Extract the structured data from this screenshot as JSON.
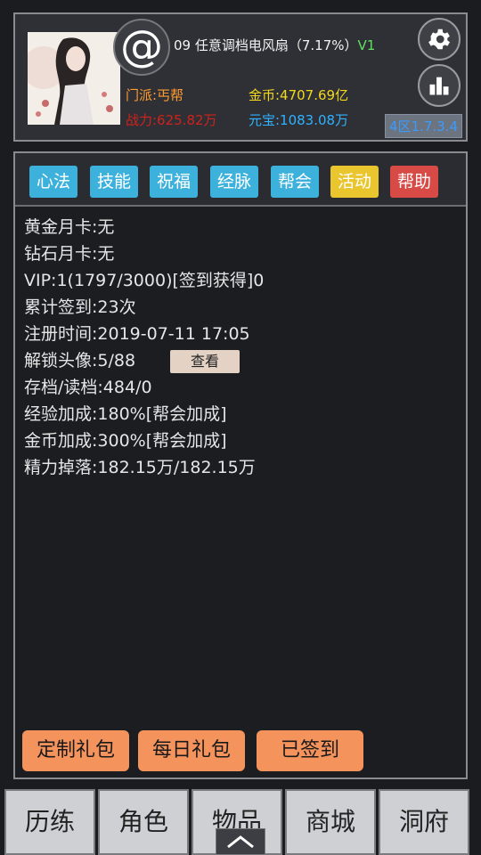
{
  "header": {
    "player_name": "09 任意调档电风扇（7.17%）",
    "vip_level": "V1",
    "sect": "门派:丐帮",
    "power": "战力:625.82万",
    "gold": "金币:4707.69亿",
    "yuanbao": "元宝:1083.08万",
    "server": "4区1.7.3.4",
    "at_symbol": "@"
  },
  "tabs": [
    {
      "label": "心法",
      "color": "#3cb1dc"
    },
    {
      "label": "技能",
      "color": "#3cb1dc"
    },
    {
      "label": "祝福",
      "color": "#3cb1dc"
    },
    {
      "label": "经脉",
      "color": "#3cb1dc"
    },
    {
      "label": "帮会",
      "color": "#3cb1dc"
    },
    {
      "label": "活动",
      "color": "#e9c52e"
    },
    {
      "label": "帮助",
      "color": "#d84a45"
    }
  ],
  "info": {
    "gold_card": "黄金月卡:无",
    "diamond_card": "钻石月卡:无",
    "vip": "VIP:1(1797/3000)[签到获得]0",
    "checkin": "累计签到:23次",
    "register": "注册时间:2019-07-11 17:05",
    "avatars": "解锁头像:5/88",
    "view_button": "查看",
    "saves": "存档/读档:484/0",
    "exp_bonus": "经验加成:180%[帮会加成]",
    "gold_bonus": "金币加成:300%[帮会加成]",
    "energy": "精力掉落:182.15万/182.15万"
  },
  "gifts": {
    "custom": "定制礼包",
    "daily": "每日礼包",
    "signed": "已签到"
  },
  "nav": [
    "历练",
    "角色",
    "物品",
    "商城",
    "洞府"
  ],
  "icons": {
    "settings": "gear-icon",
    "stats": "bar-chart-icon",
    "pull_up": "chevron-up-icon"
  }
}
